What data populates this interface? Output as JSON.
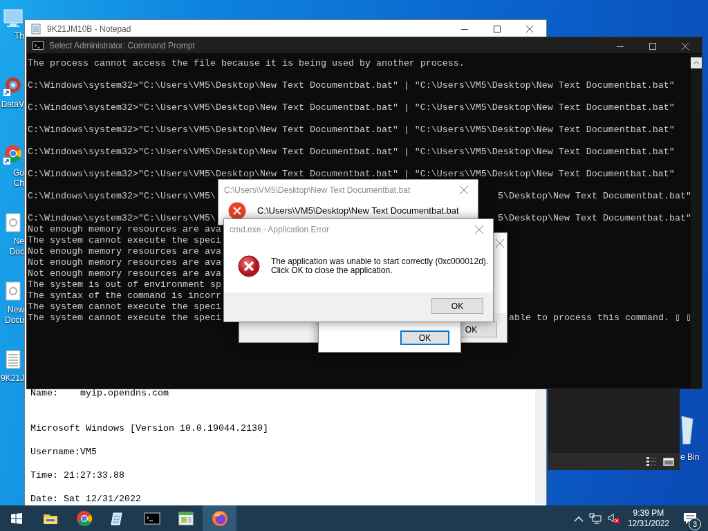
{
  "desktop_icons": [
    {
      "kind": "pc",
      "shortcut": false,
      "label_lines": [
        "Th"
      ]
    },
    {
      "kind": "app",
      "shortcut": true,
      "label_lines": [
        "DataV"
      ]
    },
    {
      "kind": "chrome",
      "shortcut": true,
      "label_lines": [
        "Go",
        "Ch"
      ]
    },
    {
      "kind": "text-file",
      "shortcut": false,
      "label_lines": [
        "Ne",
        "Doc"
      ]
    },
    {
      "kind": "text-file",
      "shortcut": false,
      "label_lines": [
        "New",
        "Docu"
      ]
    },
    {
      "kind": "notepad-file",
      "shortcut": false,
      "label_lines": [
        "9K21J"
      ]
    }
  ],
  "notepad": {
    "title": "9K21JM10B - Notepad",
    "lines": [
      {
        "kind": "text",
        "text": "Name:    myip.opendns.com"
      },
      {
        "kind": "blank"
      },
      {
        "kind": "blank"
      },
      {
        "kind": "text",
        "text": "Microsoft Windows [Version 10.0.19044.2130]"
      },
      {
        "kind": "blank"
      },
      {
        "kind": "text",
        "text": "Username:VM5"
      },
      {
        "kind": "blank"
      },
      {
        "kind": "text",
        "text": "Time: 21:27:33.88"
      },
      {
        "kind": "blank"
      },
      {
        "kind": "text",
        "text": "Date: Sat 12/31/2022"
      }
    ]
  },
  "command_prompt": {
    "title": "Select Administrator:  Command Prompt",
    "lines": [
      {
        "kind": "text",
        "left": "The process cannot access the file because it is being used by another process."
      },
      {
        "kind": "blank"
      },
      {
        "kind": "text",
        "left": "C:\\Windows\\system32>\"C:\\Users\\VM5\\Desktop\\New Text Documentbat.bat\" | \"C:\\Users\\VM5\\Desktop\\New Text Documentbat.bat\""
      },
      {
        "kind": "blank"
      },
      {
        "kind": "text",
        "left": "C:\\Windows\\system32>\"C:\\Users\\VM5\\Desktop\\New Text Documentbat.bat\" | \"C:\\Users\\VM5\\Desktop\\New Text Documentbat.bat\""
      },
      {
        "kind": "blank"
      },
      {
        "kind": "text",
        "left": "C:\\Windows\\system32>\"C:\\Users\\VM5\\Desktop\\New Text Documentbat.bat\" | \"C:\\Users\\VM5\\Desktop\\New Text Documentbat.bat\""
      },
      {
        "kind": "blank"
      },
      {
        "kind": "text",
        "left": "C:\\Windows\\system32>\"C:\\Users\\VM5\\Desktop\\New Text Documentbat.bat\" | \"C:\\Users\\VM5\\Desktop\\New Text Documentbat.bat\""
      },
      {
        "kind": "blank"
      },
      {
        "kind": "text",
        "left": "C:\\Windows\\system32>\"C:\\Users\\VM5\\Desktop\\New Text Documentbat.bat\" | \"C:\\Users\\VM5\\Desktop\\New Text Documentbat.bat\""
      },
      {
        "kind": "blank"
      },
      {
        "kind": "text",
        "left": "C:\\Windows\\system32>\"C:\\Users\\VM5\\",
        "right": "5\\Desktop\\New Text Documentbat.bat\""
      },
      {
        "kind": "blank"
      },
      {
        "kind": "text",
        "left": "C:\\Windows\\system32>\"C:\\Users\\VM5\\",
        "right": "5\\Desktop\\New Text Documentbat.bat\""
      },
      {
        "kind": "text",
        "left": "Not enough memory resources are ava"
      },
      {
        "kind": "text",
        "left": "The system cannot execute the speci"
      },
      {
        "kind": "text",
        "left": "Not enough memory resources are ava"
      },
      {
        "kind": "text",
        "left": "Not enough memory resources are ava"
      },
      {
        "kind": "text",
        "left": "Not enough memory resources are ava"
      },
      {
        "kind": "text",
        "left": "The system is out of environment sp"
      },
      {
        "kind": "text",
        "left": "The syntax of the command is incorr"
      },
      {
        "kind": "text",
        "left": "The system cannot execute the speci"
      },
      {
        "kind": "text",
        "left": "The system cannot execute the speci",
        "right": "able to process this command. ▯ ▯"
      }
    ]
  },
  "dialogs": [
    {
      "title": "C:\\Users\\VM5\\Desktop\\New Text Documentbat.bat",
      "message_lines": [
        "C:\\Users\\VM5\\Desktop\\New Text Documentbat.bat"
      ]
    },
    {
      "button": {
        "label": "OK",
        "focused": false
      }
    },
    {
      "button": {
        "label": "OK",
        "focused": true
      }
    },
    {
      "title": "cmd.exe - Application Error",
      "message_lines": [
        "The application was unable to start correctly (0xc000012d).",
        "Click OK to close the application."
      ],
      "button": {
        "label": "OK",
        "focused": false
      }
    }
  ],
  "recycle_bin": {
    "label": "e Bin"
  },
  "taskbar": {
    "apps": [
      {
        "kind": "file-explorer",
        "active": false
      },
      {
        "kind": "chrome",
        "active": false
      },
      {
        "kind": "notepad",
        "active": false
      },
      {
        "kind": "cmd",
        "active": false
      },
      {
        "kind": "window-app",
        "active": false
      },
      {
        "kind": "firefox",
        "active": true
      }
    ],
    "volume_muted": true,
    "time": "9:39 PM",
    "date": "12/31/2022",
    "notification_count": "3"
  }
}
